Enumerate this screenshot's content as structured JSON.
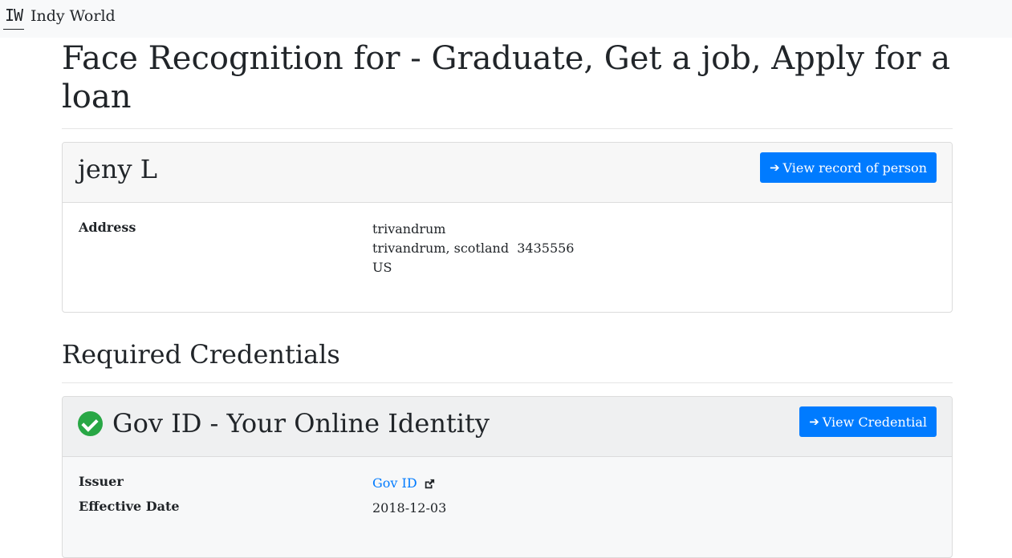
{
  "navbar": {
    "logo_text": "IW",
    "brand": "Indy World"
  },
  "page": {
    "title": "Face Recognition for - Graduate, Get a job, Apply for a loan"
  },
  "person_card": {
    "name": "jeny L",
    "button_label": "View record of person",
    "address_label": "Address",
    "address_lines": [
      "trivandrum",
      "trivandrum, scotland  3435556",
      "US"
    ]
  },
  "section": {
    "title": "Required Credentials"
  },
  "credential_card": {
    "title": "Gov ID - Your Online Identity",
    "button_label": "View Credential",
    "issuer_label": "Issuer",
    "issuer_value": "Gov ID",
    "effective_date_label": "Effective Date",
    "effective_date_value": "2018-12-03"
  },
  "colors": {
    "primary": "#007bff",
    "success": "#28a745"
  }
}
